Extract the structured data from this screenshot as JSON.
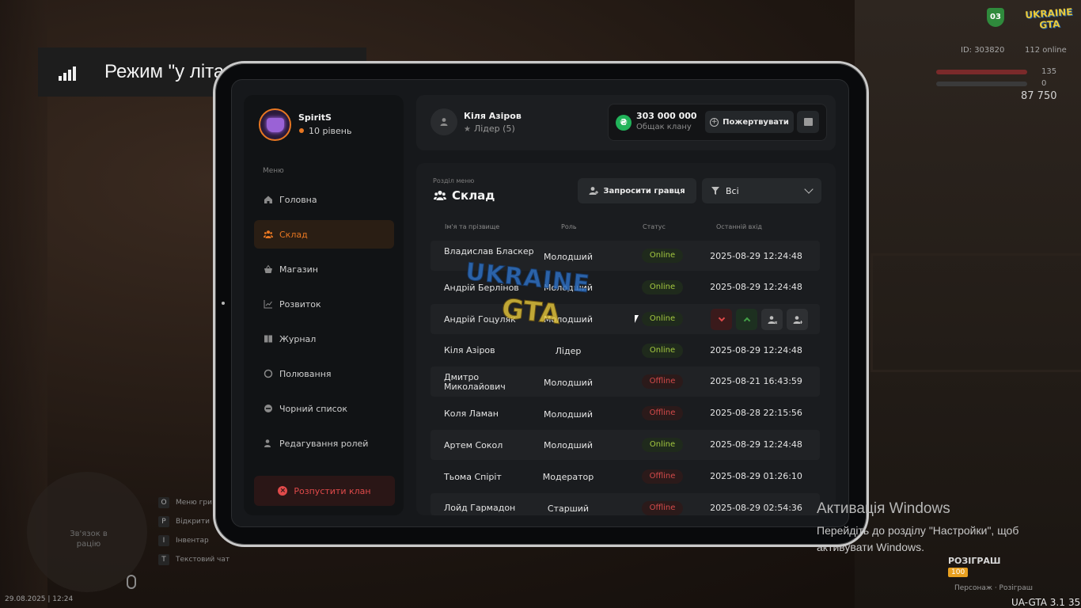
{
  "notification": {
    "text": "Режим \"у літаку\" вимкнуто"
  },
  "hud": {
    "logo": "UKRAINE GTA",
    "badge": "03",
    "id_text": "ID: 303820",
    "online_text": "112 online",
    "health": "135",
    "armor": "0",
    "money": "87 750"
  },
  "profile": {
    "name": "SpiritS",
    "level": "10 рівень"
  },
  "sidebar": {
    "menu_caption": "Меню",
    "items": [
      {
        "label": "Головна",
        "icon": "home-icon"
      },
      {
        "label": "Склад",
        "icon": "group-icon",
        "active": true
      },
      {
        "label": "Магазин",
        "icon": "basket-icon"
      },
      {
        "label": "Розвиток",
        "icon": "chart-icon"
      },
      {
        "label": "Журнал",
        "icon": "book-icon"
      },
      {
        "label": "Полювання",
        "icon": "target-icon"
      },
      {
        "label": "Чорний список",
        "icon": "block-icon"
      },
      {
        "label": "Редагування ролей",
        "icon": "user-edit-icon"
      }
    ],
    "disband_label": "Розпустити клан"
  },
  "header": {
    "leader_name": "Кіля Азіров",
    "leader_role": "Лідер (5)",
    "treasury_amount": "303 000 000",
    "treasury_caption": "Общак клану",
    "coin_symbol": "₴",
    "donate_label": "Пожертвувати"
  },
  "section": {
    "caption": "Розділ меню",
    "title": "Склад",
    "invite_label": "Запросити гравця",
    "filter_value": "Всі"
  },
  "table": {
    "columns": [
      "Ім'я та прізвище",
      "Роль",
      "Статус",
      "Останній вхід"
    ],
    "rows": [
      {
        "name": "Владислав Бласкер",
        "role": "Молодший",
        "status": "Online",
        "last": "2025-08-29 12:24:48"
      },
      {
        "name": "Андрій Берлінов",
        "role": "Молодший",
        "status": "Online",
        "last": "2025-08-29 12:24:48"
      },
      {
        "name": "Андрій Гоцуляк",
        "role": "Молодший",
        "status": "Online",
        "last": ""
      },
      {
        "name": "Кіля Азіров",
        "role": "Лідер",
        "status": "Online",
        "last": "2025-08-29 12:24:48"
      },
      {
        "name": "Дмитро Миколайович",
        "role": "Молодший",
        "status": "Offline",
        "last": "2025-08-21 16:43:59"
      },
      {
        "name": "Коля Ламан",
        "role": "Молодший",
        "status": "Offline",
        "last": "2025-08-28 22:15:56"
      },
      {
        "name": "Артем Сокол",
        "role": "Молодший",
        "status": "Online",
        "last": "2025-08-29 12:24:48"
      },
      {
        "name": "Тьома Спіріт",
        "role": "Модератор",
        "status": "Offline",
        "last": "2025-08-29 01:26:10"
      },
      {
        "name": "Лойд Гармадон",
        "role": "Старший",
        "status": "Offline",
        "last": "2025-08-29 02:54:36"
      }
    ]
  },
  "watermark": {
    "line1": "UKRAINE",
    "line2": "GTA"
  },
  "bottom_left": {
    "radar_text": "Зв'язок в рацію",
    "hints": [
      {
        "key": "O",
        "label": "Меню гри"
      },
      {
        "key": "P",
        "label": "Відкрити"
      },
      {
        "key": "I",
        "label": "Інвентар"
      },
      {
        "key": "T",
        "label": "Текстовий чат"
      }
    ],
    "datetime": "29.08.2025 | 12:24"
  },
  "activation": {
    "title": "Активація Windows",
    "line1": "Перейдіть до розділу \"Настройки\", щоб",
    "line2": "активувати Windows."
  },
  "promo": {
    "title": "РОЗІГРАШ",
    "badge": "100",
    "sub": "Персонаж · Розіграш"
  },
  "footer": {
    "version": "UA-GTA 3.1",
    "fps": "35"
  },
  "colors": {
    "accent": "#e87722",
    "online": "#a4c93f",
    "offline": "#d44a4a",
    "coin": "#21b35a"
  }
}
